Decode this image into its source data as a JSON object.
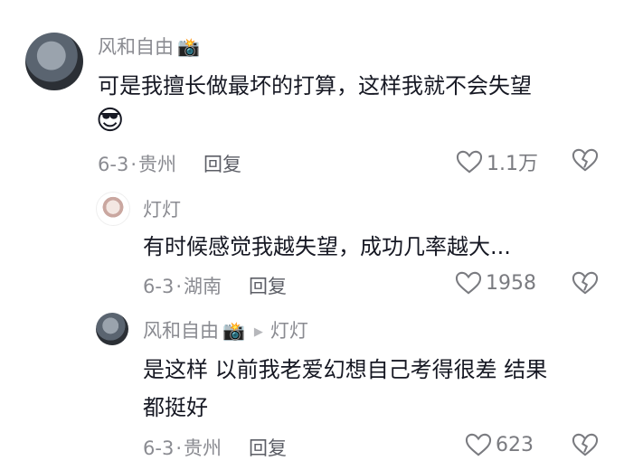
{
  "comments": [
    {
      "user": "风和自由",
      "badge_icon": "camera-icon",
      "text": "可是我擅长做最坏的打算，这样我就不会失望",
      "emoji": "😎",
      "date": "6-3",
      "location": "贵州",
      "reply_label": "回复",
      "likes": "1.1万"
    },
    {
      "user": "灯灯",
      "text": "有时候感觉我越失望，成功几率越大...",
      "date": "6-3",
      "location": "湖南",
      "reply_label": "回复",
      "likes": "1958"
    },
    {
      "user": "风和自由",
      "badge_icon": "camera-icon",
      "reply_to": "灯灯",
      "text_line1": "是这样 以前我老爱幻想自己考得很差 结果",
      "text_line2": "都挺好",
      "date": "6-3",
      "location": "贵州",
      "reply_label": "回复",
      "likes": "623"
    }
  ]
}
